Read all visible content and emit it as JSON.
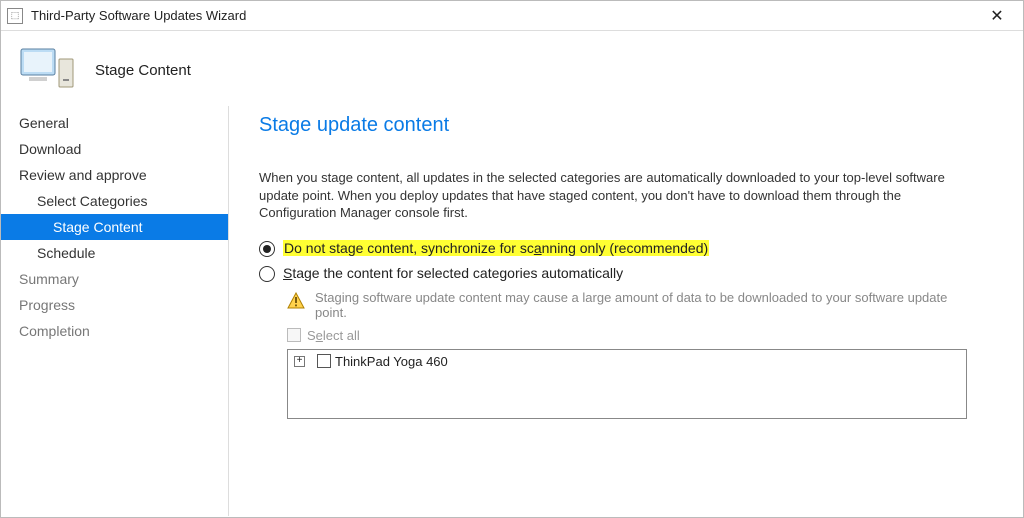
{
  "titlebar": {
    "title": "Third-Party Software Updates Wizard",
    "close_glyph": "✕"
  },
  "header": {
    "title": "Stage Content"
  },
  "sidebar": {
    "items": [
      {
        "label": "General",
        "cls": "item"
      },
      {
        "label": "Download",
        "cls": "item"
      },
      {
        "label": "Review and approve",
        "cls": "item"
      },
      {
        "label": "Select Categories",
        "cls": "item sub"
      },
      {
        "label": "Stage Content",
        "cls": "item sub2 selected"
      },
      {
        "label": "Schedule",
        "cls": "item sub"
      },
      {
        "label": "Summary",
        "cls": "item gray"
      },
      {
        "label": "Progress",
        "cls": "item gray"
      },
      {
        "label": "Completion",
        "cls": "item gray"
      }
    ]
  },
  "main": {
    "heading": "Stage update content",
    "description": "When you stage content, all updates in the selected categories are automatically downloaded to your top-level software update point. When you deploy updates that have staged content, you don't have to download them through the Configuration Manager console first.",
    "option1_pre": "D",
    "option1_mid": "o not stage content, synchronize for sc",
    "option1_accel": "a",
    "option1_post": "nning only (recommended)",
    "option2_accel": "S",
    "option2_rest": "tage the content for selected categories automatically",
    "staging_note": "Staging software update content may cause a large amount of data to be downloaded to your software update point.",
    "select_all_accel": "e",
    "select_all_pre": "S",
    "select_all_post": "lect all",
    "tree_item": "ThinkPad Yoga 460"
  }
}
